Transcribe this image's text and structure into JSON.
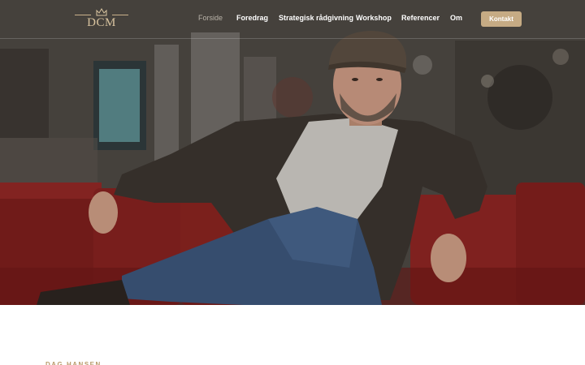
{
  "brand": {
    "logo_text": "DCM",
    "accent_color": "#c6ab84"
  },
  "nav": {
    "items": [
      {
        "label": "Forside",
        "active": true
      },
      {
        "label": "Foredrag"
      },
      {
        "label": "Strategisk rådgivning"
      },
      {
        "label": "Workshop"
      },
      {
        "label": "Referencer"
      },
      {
        "label": "Om"
      }
    ],
    "cta_label": "Kontakt"
  },
  "hero": {
    "image": "photo-man-sitting-on-red-sofa"
  },
  "section": {
    "eyebrow": "DAG HANSEN"
  }
}
